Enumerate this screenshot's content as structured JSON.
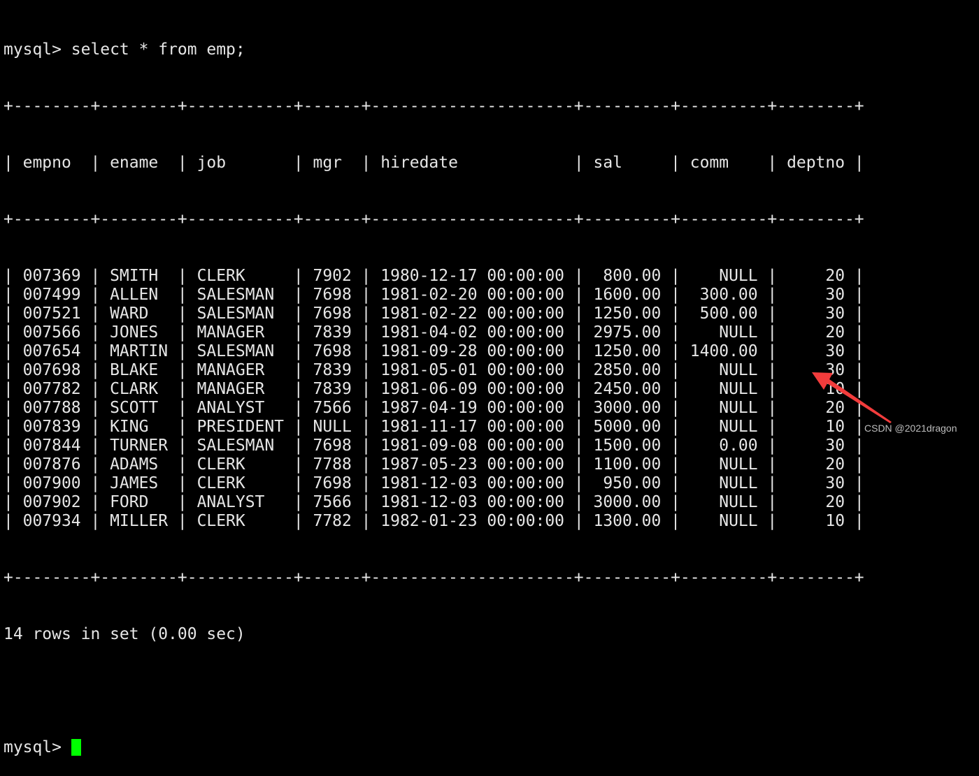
{
  "terminal": {
    "prompt": "mysql> ",
    "command": "select * from emp;",
    "columns": [
      "empno",
      "ename",
      "job",
      "mgr",
      "hiredate",
      "sal",
      "comm",
      "deptno"
    ],
    "align": [
      "l",
      "l",
      "l",
      "r",
      "l",
      "r",
      "r",
      "r"
    ],
    "rows": [
      [
        "007369",
        "SMITH",
        "CLERK",
        "7902",
        "1980-12-17 00:00:00",
        "800.00",
        "NULL",
        "20"
      ],
      [
        "007499",
        "ALLEN",
        "SALESMAN",
        "7698",
        "1981-02-20 00:00:00",
        "1600.00",
        "300.00",
        "30"
      ],
      [
        "007521",
        "WARD",
        "SALESMAN",
        "7698",
        "1981-02-22 00:00:00",
        "1250.00",
        "500.00",
        "30"
      ],
      [
        "007566",
        "JONES",
        "MANAGER",
        "7839",
        "1981-04-02 00:00:00",
        "2975.00",
        "NULL",
        "20"
      ],
      [
        "007654",
        "MARTIN",
        "SALESMAN",
        "7698",
        "1981-09-28 00:00:00",
        "1250.00",
        "1400.00",
        "30"
      ],
      [
        "007698",
        "BLAKE",
        "MANAGER",
        "7839",
        "1981-05-01 00:00:00",
        "2850.00",
        "NULL",
        "30"
      ],
      [
        "007782",
        "CLARK",
        "MANAGER",
        "7839",
        "1981-06-09 00:00:00",
        "2450.00",
        "NULL",
        "10"
      ],
      [
        "007788",
        "SCOTT",
        "ANALYST",
        "7566",
        "1987-04-19 00:00:00",
        "3000.00",
        "NULL",
        "20"
      ],
      [
        "007839",
        "KING",
        "PRESIDENT",
        "NULL",
        "1981-11-17 00:00:00",
        "5000.00",
        "NULL",
        "10"
      ],
      [
        "007844",
        "TURNER",
        "SALESMAN",
        "7698",
        "1981-09-08 00:00:00",
        "1500.00",
        "0.00",
        "30"
      ],
      [
        "007876",
        "ADAMS",
        "CLERK",
        "7788",
        "1987-05-23 00:00:00",
        "1100.00",
        "NULL",
        "20"
      ],
      [
        "007900",
        "JAMES",
        "CLERK",
        "7698",
        "1981-12-03 00:00:00",
        "950.00",
        "NULL",
        "30"
      ],
      [
        "007902",
        "FORD",
        "ANALYST",
        "7566",
        "1981-12-03 00:00:00",
        "3000.00",
        "NULL",
        "20"
      ],
      [
        "007934",
        "MILLER",
        "CLERK",
        "7782",
        "1982-01-23 00:00:00",
        "1300.00",
        "NULL",
        "10"
      ]
    ],
    "result_summary": "14 rows in set (0.00 sec)",
    "cursor_color": "#00ff00"
  },
  "annotation": {
    "arrow_color": "#f23c3c",
    "watermark": "CSDN @2021dragon"
  }
}
